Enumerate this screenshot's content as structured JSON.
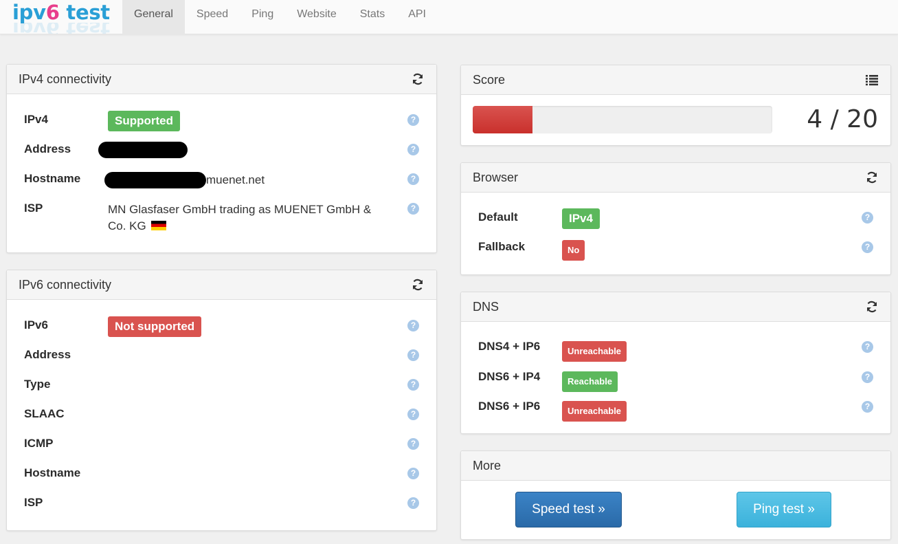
{
  "brand": {
    "part1": "ipv",
    "part2": "6",
    "part3": " test"
  },
  "nav": {
    "items": [
      "General",
      "Speed",
      "Ping",
      "Website",
      "Stats",
      "API"
    ],
    "active": "General"
  },
  "ipv4": {
    "title": "IPv4 connectivity",
    "rows": [
      {
        "label": "IPv4",
        "value": "Supported"
      },
      {
        "label": "Address",
        "value": ""
      },
      {
        "label": "Hostname",
        "value": "muenet.net"
      },
      {
        "label": "ISP",
        "value": "MN Glasfaser GmbH trading as MUENET GmbH & Co. KG"
      }
    ]
  },
  "ipv6": {
    "title": "IPv6 connectivity",
    "rows": [
      {
        "label": "IPv6",
        "value": "Not supported"
      },
      {
        "label": "Address"
      },
      {
        "label": "Type"
      },
      {
        "label": "SLAAC"
      },
      {
        "label": "ICMP"
      },
      {
        "label": "Hostname"
      },
      {
        "label": "ISP"
      }
    ]
  },
  "score": {
    "title": "Score",
    "text": "4 / 20",
    "value": 4,
    "max": 20
  },
  "browser": {
    "title": "Browser",
    "rows": [
      {
        "label": "Default",
        "value": "IPv4"
      },
      {
        "label": "Fallback",
        "value": "No"
      }
    ]
  },
  "dns": {
    "title": "DNS",
    "rows": [
      {
        "label": "DNS4 + IP6",
        "value": "Unreachable"
      },
      {
        "label": "DNS6 + IP4",
        "value": "Reachable"
      },
      {
        "label": "DNS6 + IP6",
        "value": "Unreachable"
      }
    ]
  },
  "more": {
    "title": "More",
    "speed_button": "Speed test »",
    "ping_button": "Ping test »"
  },
  "icons": {
    "refresh": "refresh-icon",
    "help": "question-circle-icon",
    "list": "list-icon",
    "flag": "germany-flag-icon"
  },
  "colors": {
    "success": "#5cb85c",
    "danger": "#d9534f",
    "primary": "#337ab7",
    "info": "#5bc0de"
  }
}
